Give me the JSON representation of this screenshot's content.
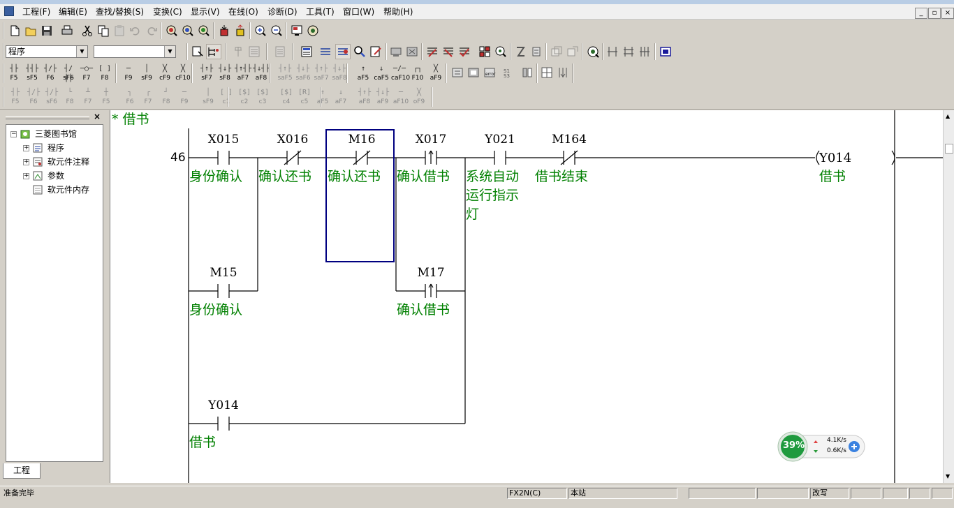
{
  "menu": [
    "工程(F)",
    "编辑(E)",
    "查找/替换(S)",
    "变换(C)",
    "显示(V)",
    "在线(O)",
    "诊断(D)",
    "工具(T)",
    "窗口(W)",
    "帮助(H)"
  ],
  "toolbar": {
    "mode_combo": "程序",
    "second_combo": ""
  },
  "fkeys_row1": [
    {
      "sym": "┤├",
      "label": "F5"
    },
    {
      "sym": "┤┤├",
      "label": "sF5"
    },
    {
      "sym": "┤/├",
      "label": "F6"
    },
    {
      "sym": "┤/┤├",
      "label": "sF6"
    },
    {
      "sym": "─○─",
      "label": "F7"
    },
    {
      "sym": "[ ]",
      "label": "F8"
    },
    {
      "sym": "─",
      "label": "F9"
    },
    {
      "sym": "│",
      "label": "sF9"
    },
    {
      "sym": "╳",
      "label": "cF9"
    },
    {
      "sym": "╳",
      "label": "cF10"
    },
    {
      "sym": "┤↑├",
      "label": "sF7"
    },
    {
      "sym": "┤↓├",
      "label": "sF8"
    },
    {
      "sym": "┤↑┤├",
      "label": "aF7"
    },
    {
      "sym": "┤↓┤├",
      "label": "aF8"
    },
    {
      "sym": "┤↑├",
      "label": "saF5"
    },
    {
      "sym": "┤↓├",
      "label": "saF6"
    },
    {
      "sym": "┤↑├",
      "label": "saF7"
    },
    {
      "sym": "┤↓├",
      "label": "saF8"
    },
    {
      "sym": "↑",
      "label": "aF5"
    },
    {
      "sym": "↓",
      "label": "caF5"
    },
    {
      "sym": "─/─",
      "label": "caF10"
    },
    {
      "sym": "┌┐",
      "label": "F10"
    },
    {
      "sym": "╳",
      "label": "aF9"
    }
  ],
  "fkeys_row2": [
    {
      "sym": "┤├",
      "label": "F5"
    },
    {
      "sym": "┤/├",
      "label": "F6"
    },
    {
      "sym": "┤/├",
      "label": "sF6"
    },
    {
      "sym": "└",
      "label": "F8"
    },
    {
      "sym": "┴",
      "label": "F7"
    },
    {
      "sym": "┼",
      "label": "F5"
    },
    {
      "sym": "┐",
      "label": "F6"
    },
    {
      "sym": "┌",
      "label": "F7"
    },
    {
      "sym": "┘",
      "label": "F8"
    },
    {
      "sym": "─",
      "label": "F9"
    },
    {
      "sym": "│",
      "label": "sF9"
    },
    {
      "sym": "[ ]",
      "label": "c1"
    },
    {
      "sym": "[$]",
      "label": "c2"
    },
    {
      "sym": "[$]",
      "label": "c3"
    },
    {
      "sym": "[$]",
      "label": "c4"
    },
    {
      "sym": "[R]",
      "label": "c5"
    },
    {
      "sym": "↑",
      "label": "aF5"
    },
    {
      "sym": "↓",
      "label": "aF7"
    },
    {
      "sym": "┤↑├",
      "label": "aF8"
    },
    {
      "sym": "┤↓├",
      "label": "aF9"
    },
    {
      "sym": "─",
      "label": "aF10"
    },
    {
      "sym": "╳",
      "label": "oF9"
    }
  ],
  "tree": {
    "root": "三菱图书馆",
    "items": [
      "程序",
      "软元件注释",
      "参数",
      "软元件内存"
    ]
  },
  "left_tab": "工程",
  "chart_data": {
    "type": "table",
    "comment": "* 借书",
    "step": "46",
    "rows": [
      [
        {
          "device": "X015",
          "kind": "NO",
          "comment": "身份确认"
        },
        {
          "device": "X016",
          "kind": "NC",
          "comment": "确认还书"
        },
        {
          "device": "M16",
          "kind": "NC",
          "comment": "确认还书"
        },
        {
          "device": "X017",
          "kind": "PULSE",
          "comment": "确认借书"
        },
        {
          "device": "Y021",
          "kind": "NO",
          "comment": "系统自动运行指示灯",
          "comment_lines": [
            "系统自动",
            "运行指示",
            "灯"
          ]
        },
        {
          "device": "M164",
          "kind": "NC",
          "comment": "借书结束"
        }
      ],
      [
        {
          "device": "M15",
          "kind": "NO",
          "comment": "身份确认",
          "col": 0
        },
        {
          "device": "M17",
          "kind": "PULSE",
          "comment": "确认借书",
          "col": 3
        }
      ],
      [
        {
          "device": "Y014",
          "kind": "NO",
          "comment": "借书",
          "col": 0
        }
      ]
    ],
    "coil": {
      "device": "Y014",
      "comment": "借书"
    }
  },
  "status": {
    "message": "准备完毕",
    "plc": "FX2N(C)",
    "station": "本站",
    "mode": "改写"
  },
  "net_widget": {
    "percent": "39%",
    "up": "4.1K/s",
    "down": "0.6K/s"
  },
  "colors": {
    "ladder_text": "#008000",
    "ladder_line": "#000000",
    "cursor": "#000080",
    "ball": "#1f9a3e"
  }
}
